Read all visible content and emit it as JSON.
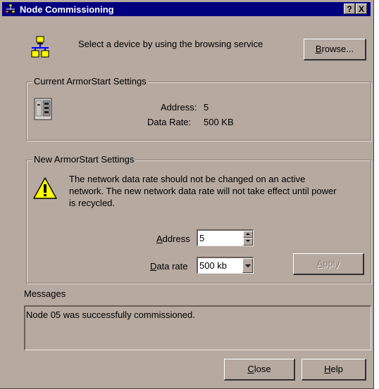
{
  "window": {
    "title": "Node Commissioning",
    "help_btn": "?",
    "close_btn": "X"
  },
  "browse": {
    "prompt": "Select a device by using the browsing service",
    "button_pre": "B",
    "button_post": "rowse..."
  },
  "current": {
    "legend": "Current ArmorStart Settings",
    "address_label": "Address:",
    "address_value": "5",
    "rate_label": "Data Rate:",
    "rate_value": "500 KB"
  },
  "new_settings": {
    "legend": "New ArmorStart Settings",
    "warning_line1": "The network data rate should not be changed on an active",
    "warning_line2": "network. The new network data rate will not take effect until power",
    "warning_line3": "is recycled.",
    "address_label_pre": "A",
    "address_label_post": "ddress",
    "address_value": "5",
    "rate_label_pre": "D",
    "rate_label_post": "ata rate",
    "rate_value": "500 kb",
    "apply_label_pre": "A",
    "apply_label_post": "pply"
  },
  "messages": {
    "label": "Messages",
    "text": "Node 05 was successfully commissioned."
  },
  "footer": {
    "close_pre": "C",
    "close_post": "lose",
    "help_pre": "H",
    "help_post": "elp"
  }
}
